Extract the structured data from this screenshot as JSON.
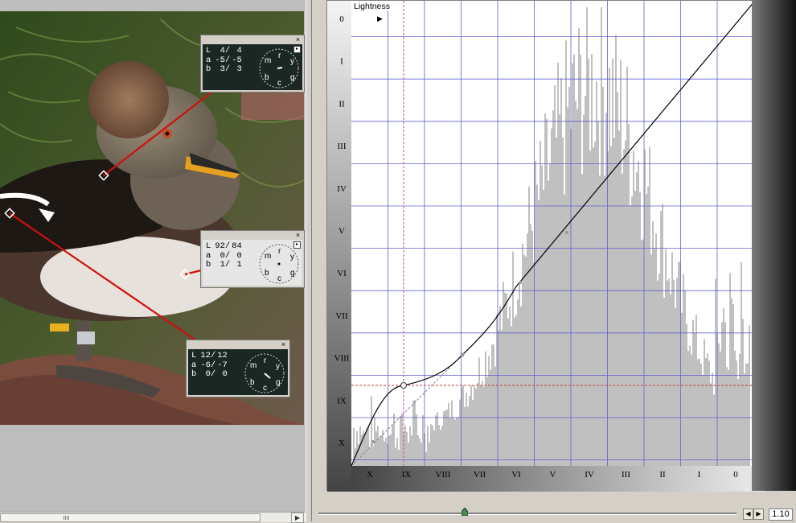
{
  "curve": {
    "channel_label": "Lightness",
    "zone_labels_y": [
      "0",
      "I",
      "II",
      "III",
      "IV",
      "V",
      "VI",
      "VII",
      "VIII",
      "IX",
      "X"
    ],
    "zone_labels_x": [
      "X",
      "IX",
      "VIII",
      "VII",
      "VI",
      "V",
      "IV",
      "III",
      "II",
      "I",
      "0"
    ]
  },
  "readouts": [
    {
      "L": "4/",
      "L2": "4",
      "a": "-5/",
      "a2": "-5",
      "b": "3/",
      "b2": "3",
      "dial": [
        "m",
        "r",
        "y",
        "b",
        "c",
        "g"
      ]
    },
    {
      "L": "92/",
      "L2": "84",
      "a": "0/",
      "a2": "0",
      "b": "1/",
      "b2": "1",
      "dial": [
        "m",
        "r",
        "y",
        "b",
        "c",
        "g"
      ]
    },
    {
      "L": "12/",
      "L2": "12",
      "a": "-6/",
      "a2": "-7",
      "b": "0/",
      "b2": "0",
      "dial": [
        "m",
        "r",
        "y",
        "b",
        "c",
        "g"
      ]
    }
  ],
  "readout_keys": {
    "l": "L",
    "a": "a",
    "b": "b"
  },
  "close_glyph": "×",
  "zoom": {
    "value": "1.10"
  },
  "colors": {
    "grid": "#6060d0",
    "histogram": "#c0c0c0",
    "marker_line": "#d01010",
    "dial_bg": "#1b2722"
  },
  "icons": {
    "close": "close-icon",
    "pin": "pin-icon",
    "arrow_left": "left-arrow-icon",
    "arrow_right": "right-arrow-icon",
    "play": "play-icon"
  }
}
